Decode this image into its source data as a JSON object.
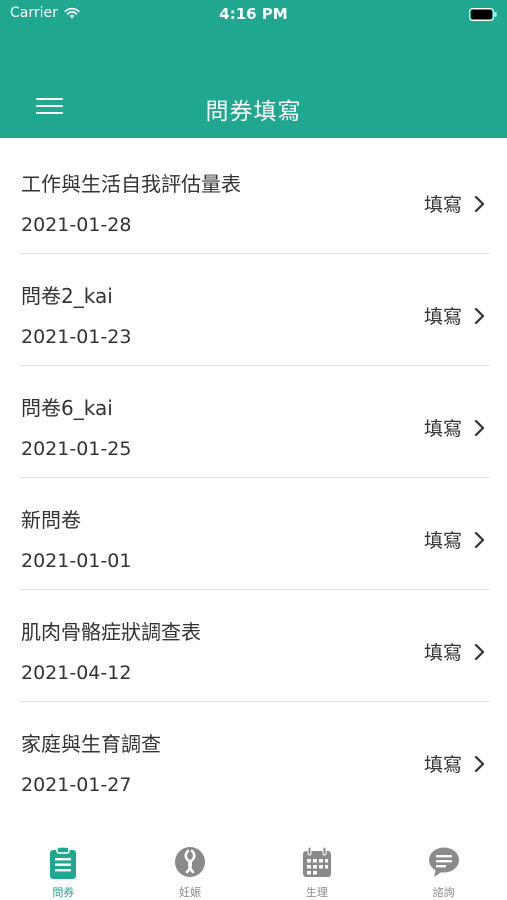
{
  "colors": {
    "accent": "#1fa88f",
    "inactive_icon": "#8a8a8a",
    "text": "#333333",
    "divider": "#e3e3e3"
  },
  "status_bar": {
    "carrier": "Carrier",
    "time": "4:16 PM",
    "wifi_icon": "wifi-icon",
    "battery_icon": "battery-icon"
  },
  "nav": {
    "menu_icon": "hamburger-menu-icon",
    "title": "問券填寫"
  },
  "questionnaires": [
    {
      "title": "工作與生活自我評估量表",
      "date": "2021-01-28",
      "action": "填寫"
    },
    {
      "title": "問卷2_kai",
      "date": "2021-01-23",
      "action": "填寫"
    },
    {
      "title": "問卷6_kai",
      "date": "2021-01-25",
      "action": "填寫"
    },
    {
      "title": "新問卷",
      "date": "2021-01-01",
      "action": "填寫"
    },
    {
      "title": "肌肉骨骼症狀調查表",
      "date": "2021-04-12",
      "action": "填寫"
    },
    {
      "title": "家庭與生育調查",
      "date": "2021-01-27",
      "action": "填寫"
    }
  ],
  "tabbar": {
    "items": [
      {
        "label": "問券",
        "icon": "clipboard-icon",
        "active": true
      },
      {
        "label": "妊娠",
        "icon": "pregnancy-icon",
        "active": false
      },
      {
        "label": "生理",
        "icon": "calendar-icon",
        "active": false
      },
      {
        "label": "諮詢",
        "icon": "chat-bubble-icon",
        "active": false
      }
    ]
  }
}
